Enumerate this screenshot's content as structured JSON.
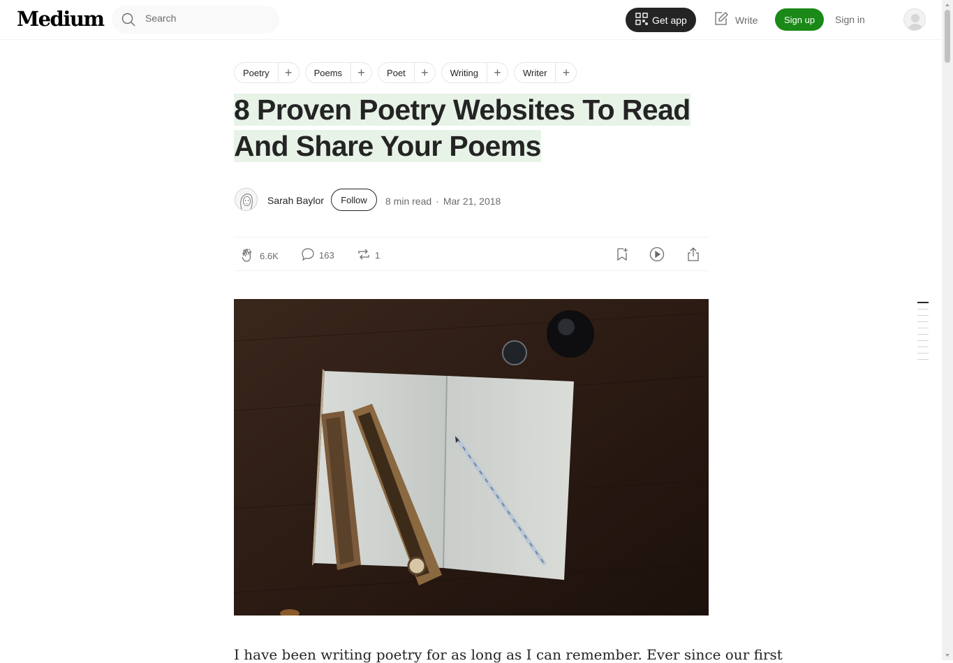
{
  "header": {
    "logo": "Medium",
    "search_placeholder": "Search",
    "get_app": "Get app",
    "write": "Write",
    "sign_up": "Sign up",
    "sign_in": "Sign in"
  },
  "tags": [
    "Poetry",
    "Poems",
    "Poet",
    "Writing",
    "Writer"
  ],
  "article": {
    "title_line1": "8 Proven Poetry Websites To Read",
    "title_line2": "And Share Your Poems",
    "author": "Sarah Baylor",
    "follow": "Follow",
    "read_time": "8 min read",
    "separator": "·",
    "date": "Mar 21, 2018",
    "claps": "6.6K",
    "responses": "163",
    "reposts": "1",
    "first_paragraph": "I have been writing poetry for as long as I can remember. Ever since our first"
  },
  "colors": {
    "accent_green": "#1a8917",
    "highlight": "#e8f3e8",
    "text": "#242424",
    "muted": "#6b6b6b"
  }
}
